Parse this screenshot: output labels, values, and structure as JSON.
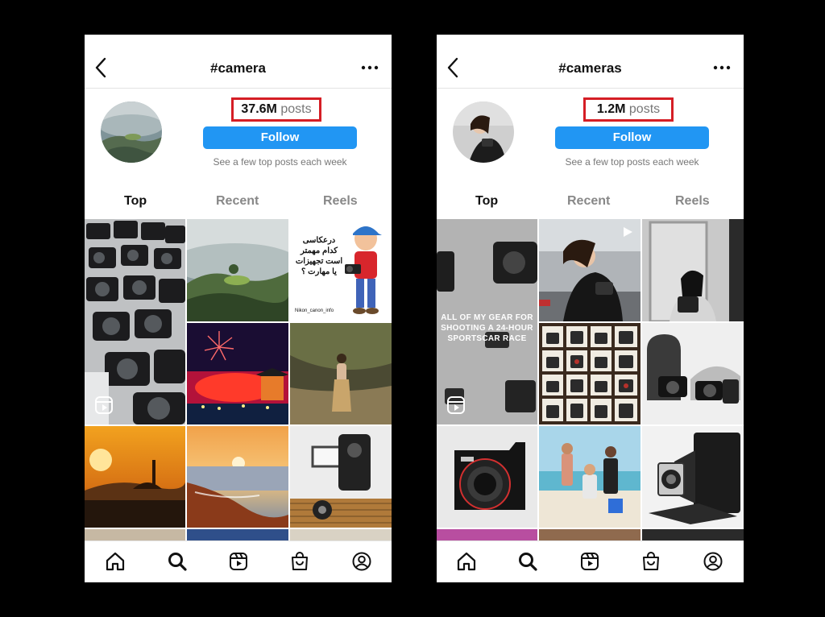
{
  "screens": [
    {
      "hashtag": "#camera",
      "post_count": "37.6M",
      "posts_label": "posts",
      "follow_label": "Follow",
      "subtitle": "See a few top posts each week",
      "tabs": [
        "Top",
        "Recent",
        "Reels"
      ],
      "active_tab": "Top",
      "grid_cells": [
        {
          "desc": "rows of cameras",
          "reel": true
        },
        {
          "desc": "misty valley"
        },
        {
          "desc": "persian text cartoon photographer",
          "fa_text": "درعکاسی کدام مهمتر است تجهیزات یا مهارت ؟",
          "handle": "Nikon_canon_info"
        },
        {
          "desc": "fireworks temple"
        },
        {
          "desc": "woman in forest"
        },
        {
          "desc": "sunset silhouette"
        },
        {
          "desc": "sea sunrise waves"
        },
        {
          "desc": "camera rig studio"
        }
      ]
    },
    {
      "hashtag": "#cameras",
      "post_count": "1.2M",
      "posts_label": "posts",
      "follow_label": "Follow",
      "subtitle": "See a few top posts each week",
      "tabs": [
        "Top",
        "Recent",
        "Reels"
      ],
      "active_tab": "Top",
      "grid_cells": [
        {
          "desc": "camera gear wall",
          "reel": true,
          "overlay": "ALL OF MY GEAR FOR SHOOTING A 24-HOUR SPORTSCAR RACE"
        },
        {
          "desc": "woman with camera",
          "video": true
        },
        {
          "desc": "bw woman with camera"
        },
        {
          "desc": "vintage camera shelf"
        },
        {
          "desc": "camera bag gear"
        },
        {
          "desc": "canon dslr"
        },
        {
          "desc": "three men beach"
        },
        {
          "desc": "vintage folding camera"
        }
      ]
    }
  ],
  "colors": {
    "follow_blue": "#2196f3",
    "highlight_red": "#d51e25"
  },
  "nav_icons": [
    "home-icon",
    "search-icon",
    "reels-icon",
    "shop-icon",
    "profile-icon"
  ]
}
